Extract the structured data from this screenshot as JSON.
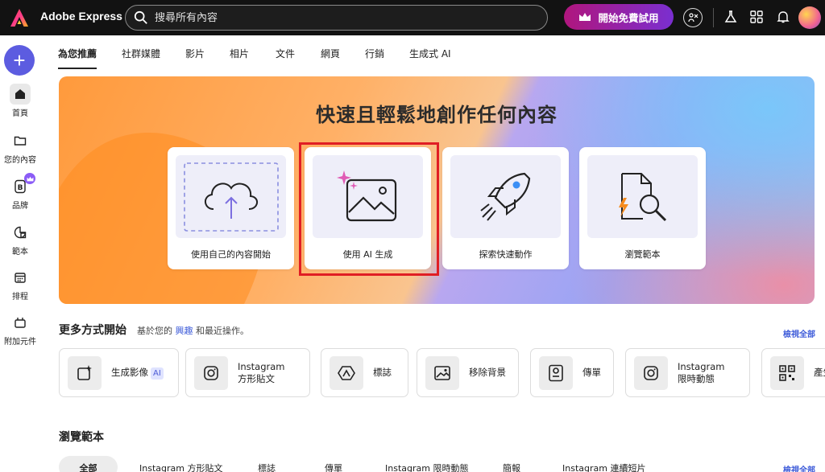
{
  "app": {
    "name": "Adobe Express"
  },
  "search": {
    "placeholder": "搜尋所有內容"
  },
  "header": {
    "cta_label": "開始免費試用"
  },
  "sidebar": {
    "items": [
      {
        "label": "首頁"
      },
      {
        "label": "您的內容"
      },
      {
        "label": "品牌"
      },
      {
        "label": "範本"
      },
      {
        "label": "排程"
      },
      {
        "label": "附加元件"
      }
    ]
  },
  "tabs": [
    "為您推薦",
    "社群媒體",
    "影片",
    "相片",
    "文件",
    "網頁",
    "行銷",
    "生成式 AI"
  ],
  "hero": {
    "title": "快速且輕鬆地創作任何內容",
    "cards": [
      {
        "label": "使用自己的內容開始"
      },
      {
        "label": "使用 AI 生成"
      },
      {
        "label": "探索快速動作"
      },
      {
        "label": "瀏覽範本"
      }
    ]
  },
  "more_ways": {
    "title": "更多方式開始",
    "subtitle_prefix": "基於您的",
    "subtitle_link": "興趣",
    "subtitle_suffix": "和最近操作。",
    "view_all": "檢視全部",
    "items": [
      {
        "line1": "生成影像",
        "badge": "AI"
      },
      {
        "line1": "Instagram",
        "line2": "方形貼文"
      },
      {
        "line1": "標誌"
      },
      {
        "line1": "移除背景"
      },
      {
        "line1": "傳單"
      },
      {
        "line1": "Instagram",
        "line2": "限時動態"
      },
      {
        "line1": "產生"
      }
    ]
  },
  "browse": {
    "title": "瀏覽範本",
    "view_all": "檢視全部",
    "chips": [
      "全部",
      "Instagram 方形貼文",
      "標誌",
      "傳單",
      "Instagram 限時動態",
      "簡報",
      "Instagram 連續短片"
    ]
  }
}
